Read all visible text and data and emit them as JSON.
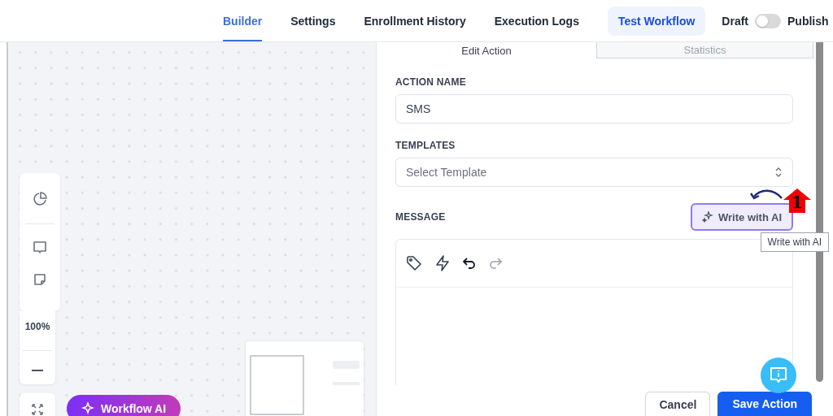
{
  "top_tabs": [
    {
      "label": "Builder",
      "selected": true
    },
    {
      "label": "Settings",
      "selected": false
    },
    {
      "label": "Enrollment History",
      "selected": false
    },
    {
      "label": "Execution Logs",
      "selected": false
    }
  ],
  "test_button": "Test Workflow",
  "publish_toggle": {
    "off_label": "Draft",
    "on_label": "Publish",
    "on": false
  },
  "canvas": {
    "zoom": "100%",
    "ai_button": "Workflow AI"
  },
  "panel": {
    "tabs": [
      {
        "label": "Edit Action",
        "selected": true
      },
      {
        "label": "Statistics",
        "selected": false
      }
    ],
    "action_name": {
      "label": "ACTION NAME",
      "value": "SMS"
    },
    "templates": {
      "label": "TEMPLATES",
      "placeholder": "Select Template"
    },
    "message": {
      "label": "MESSAGE",
      "ai_button": "Write with AI",
      "tooltip": "Write with AI"
    },
    "buttons": [
      "Cancel",
      "Save Action"
    ]
  },
  "annotation": {
    "number": "1"
  }
}
